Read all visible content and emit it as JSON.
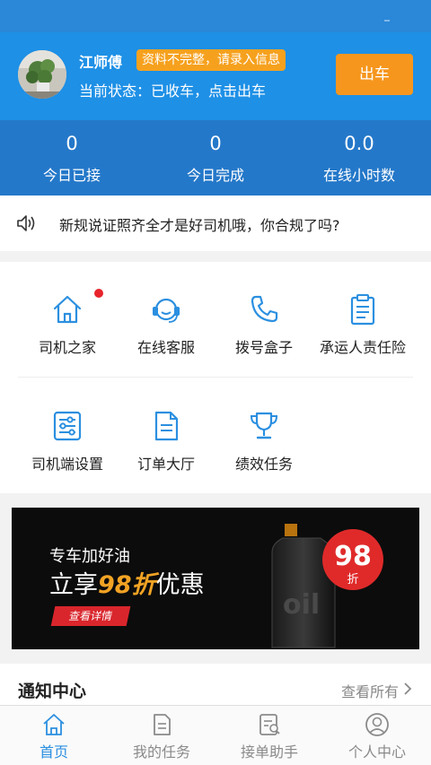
{
  "header": {
    "driver_name": "江师傅",
    "info_badge": "资料不完整，请录入信息",
    "status_text": "当前状态：已收车，点击出车",
    "depart_button": "出车"
  },
  "stats": [
    {
      "value": "0",
      "label": "今日已接"
    },
    {
      "value": "0",
      "label": "今日完成"
    },
    {
      "value": "0.0",
      "label": "在线小时数"
    }
  ],
  "notice": {
    "icon": "speaker-icon",
    "text": "新规说证照齐全才是好司机哦，你合规了吗?"
  },
  "menu": [
    {
      "label": "司机之家",
      "icon": "home-icon",
      "has_badge": true
    },
    {
      "label": "在线客服",
      "icon": "headset-icon",
      "has_badge": false
    },
    {
      "label": "拨号盒子",
      "icon": "phone-icon",
      "has_badge": false
    },
    {
      "label": "承运人责任险",
      "icon": "clipboard-icon",
      "has_badge": false
    },
    {
      "label": "司机端设置",
      "icon": "sliders-icon",
      "has_badge": false
    },
    {
      "label": "订单大厅",
      "icon": "document-icon",
      "has_badge": false
    },
    {
      "label": "绩效任务",
      "icon": "trophy-icon",
      "has_badge": false
    }
  ],
  "banner": {
    "subtitle": "专车加好油",
    "main_prefix": "立享",
    "main_highlight": "98折",
    "main_suffix": "优惠",
    "button": "查看详情",
    "badge_number": "98",
    "badge_unit": "折",
    "bottle_text": "oil"
  },
  "notifications": {
    "title": "通知中心",
    "more": "查看所有"
  },
  "tabbar": [
    {
      "label": "首页",
      "icon": "home-icon",
      "active": true
    },
    {
      "label": "我的任务",
      "icon": "task-doc-icon",
      "active": false
    },
    {
      "label": "接单助手",
      "icon": "order-search-icon",
      "active": false
    },
    {
      "label": "个人中心",
      "icon": "user-icon",
      "active": false
    }
  ],
  "colors": {
    "primary": "#1e90e6",
    "stats_bg": "#2478c9",
    "accent_orange": "#f6961d",
    "badge_red": "#e8232b",
    "tab_active": "#2b8fe0"
  }
}
